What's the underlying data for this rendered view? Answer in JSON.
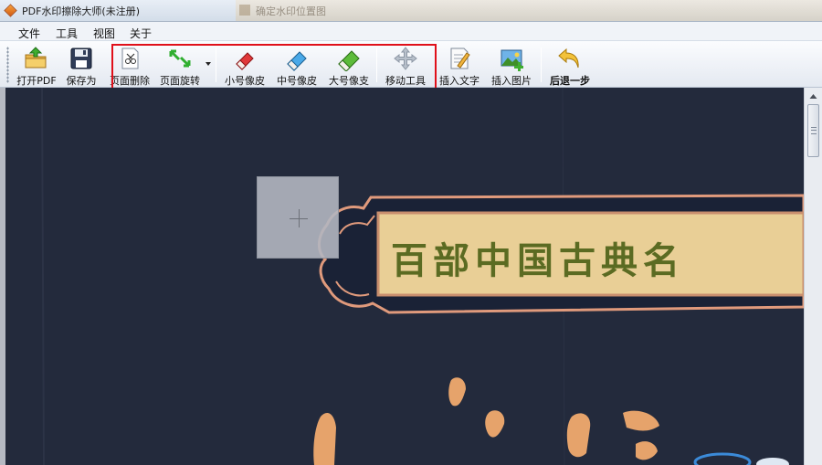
{
  "window": {
    "title": "PDF水印擦除大师(未注册)",
    "background_window_title": "确定水印位置图"
  },
  "menu": {
    "items": [
      {
        "label": "文件"
      },
      {
        "label": "工具"
      },
      {
        "label": "视图"
      },
      {
        "label": "关于"
      }
    ]
  },
  "toolbar": {
    "buttons": [
      {
        "label": "打开PDF",
        "icon": "open-folder-icon"
      },
      {
        "label": "保存为",
        "icon": "floppy-save-icon"
      },
      {
        "label": "页面删除",
        "icon": "page-delete-icon"
      },
      {
        "label": "页面旋转",
        "icon": "page-rotate-icon"
      },
      {
        "label": "小号像皮",
        "icon": "small-eraser-icon"
      },
      {
        "label": "中号像皮",
        "icon": "medium-eraser-icon"
      },
      {
        "label": "大号像支",
        "icon": "large-eraser-icon"
      },
      {
        "label": "移动工具",
        "icon": "move-tool-icon"
      },
      {
        "label": "插入文字",
        "icon": "insert-text-icon"
      },
      {
        "label": "插入图片",
        "icon": "insert-image-icon"
      },
      {
        "label": "后退一步",
        "icon": "undo-icon"
      }
    ]
  },
  "document": {
    "banner_text": "百部中国古典名"
  },
  "colors": {
    "highlight": "#e0101a",
    "banner_frame": "#e09a7c",
    "banner_fill": "#e9cf96",
    "banner_text": "#5b6b22",
    "calligraphy": "#e6a36b"
  }
}
